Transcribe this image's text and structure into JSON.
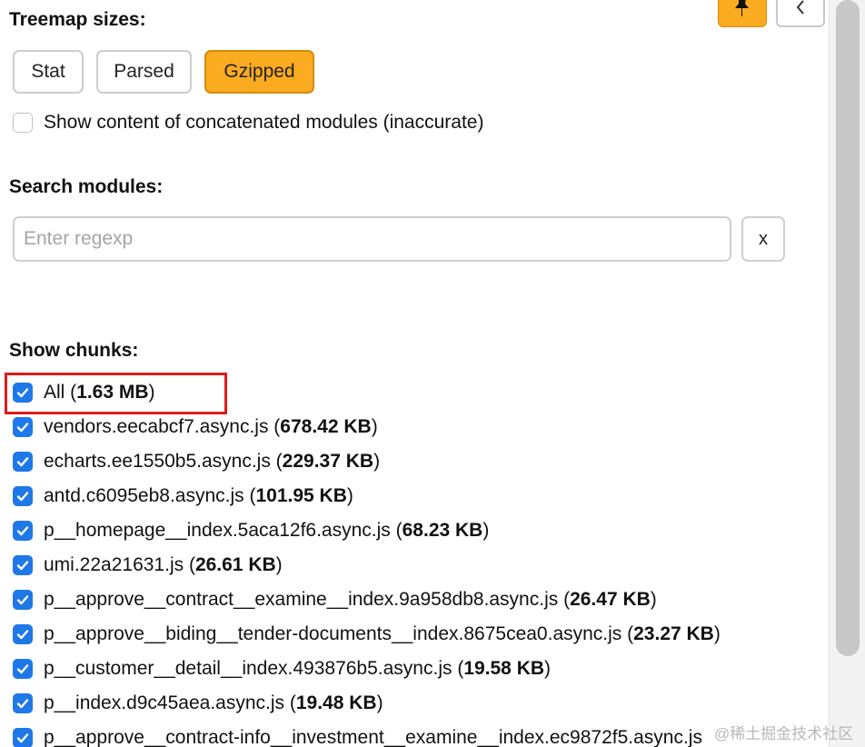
{
  "treemap": {
    "title": "Treemap sizes:",
    "buttons": [
      {
        "label": "Stat",
        "active": false
      },
      {
        "label": "Parsed",
        "active": false
      },
      {
        "label": "Gzipped",
        "active": true
      }
    ],
    "concat_label": "Show content of concatenated modules (inaccurate)",
    "concat_checked": false
  },
  "top_buttons": {
    "pin_icon": "pin-icon",
    "back_icon": "chevron-left-icon"
  },
  "search": {
    "title": "Search modules:",
    "placeholder": "Enter regexp",
    "value": "",
    "clear_label": "x"
  },
  "chunks": {
    "title": "Show chunks:",
    "items": [
      {
        "name": "All",
        "size": "1.63 MB",
        "checked": true
      },
      {
        "name": "vendors.eecabcf7.async.js",
        "size": "678.42 KB",
        "checked": true
      },
      {
        "name": "echarts.ee1550b5.async.js",
        "size": "229.37 KB",
        "checked": true
      },
      {
        "name": "antd.c6095eb8.async.js",
        "size": "101.95 KB",
        "checked": true
      },
      {
        "name": "p__homepage__index.5aca12f6.async.js",
        "size": "68.23 KB",
        "checked": true
      },
      {
        "name": "umi.22a21631.js",
        "size": "26.61 KB",
        "checked": true
      },
      {
        "name": "p__approve__contract__examine__index.9a958db8.async.js",
        "size": "26.47 KB",
        "checked": true
      },
      {
        "name": "p__approve__biding__tender-documents__index.8675cea0.async.js",
        "size": "23.27 KB",
        "checked": true
      },
      {
        "name": "p__customer__detail__index.493876b5.async.js",
        "size": "19.58 KB",
        "checked": true
      },
      {
        "name": "p__index.d9c45aea.async.js",
        "size": "19.48 KB",
        "checked": true
      },
      {
        "name": "p__approve__contract-info__investment__examine__index.ec9872f5.async.js",
        "size": "",
        "checked": true
      }
    ]
  },
  "colors": {
    "accent": "#fbab1f",
    "checkbox": "#1f78e8",
    "highlight": "#e01a1a"
  },
  "watermark": "@稀土掘金技术社区"
}
